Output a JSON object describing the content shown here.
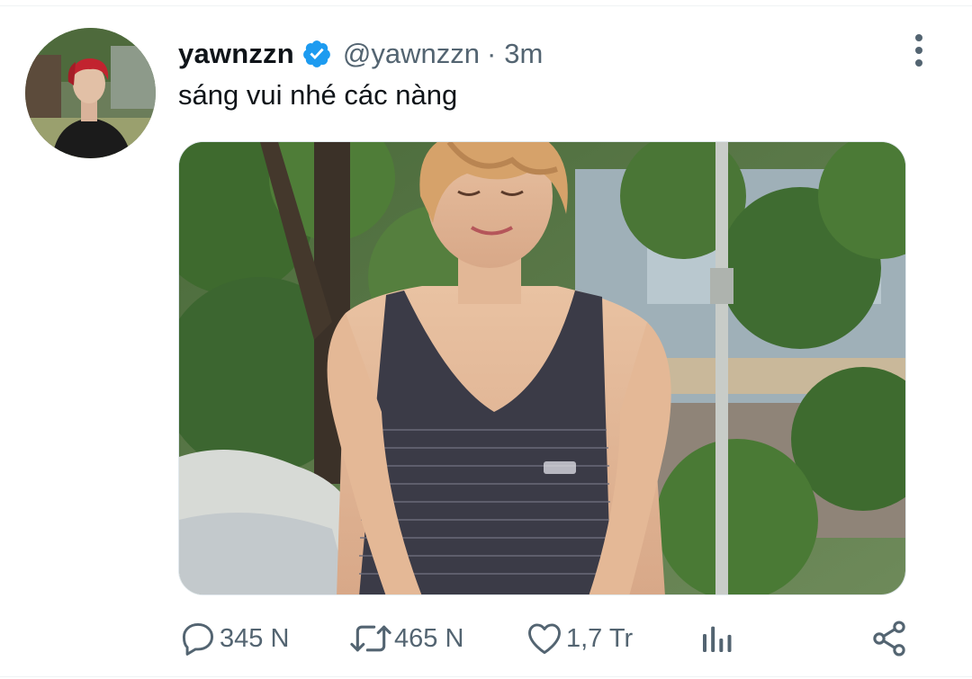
{
  "tweet": {
    "author": {
      "display_name": "yawnzzn",
      "handle": "@yawnzzn",
      "verified": true
    },
    "separator": "·",
    "time": "3m",
    "text": "sáng vui nhé các nàng"
  },
  "actions": {
    "reply_count": "345 N",
    "retweet_count": "465 N",
    "like_count": "1,7 Tr"
  },
  "icons": {
    "verified": "verified-badge-icon",
    "more": "more-vertical-icon",
    "reply": "reply-icon",
    "retweet": "retweet-icon",
    "like": "heart-icon",
    "analytics": "analytics-icon",
    "share": "share-icon"
  },
  "colors": {
    "verified_blue": "#1d9bf0",
    "secondary_text": "#536471",
    "primary_text": "#0f1419"
  }
}
